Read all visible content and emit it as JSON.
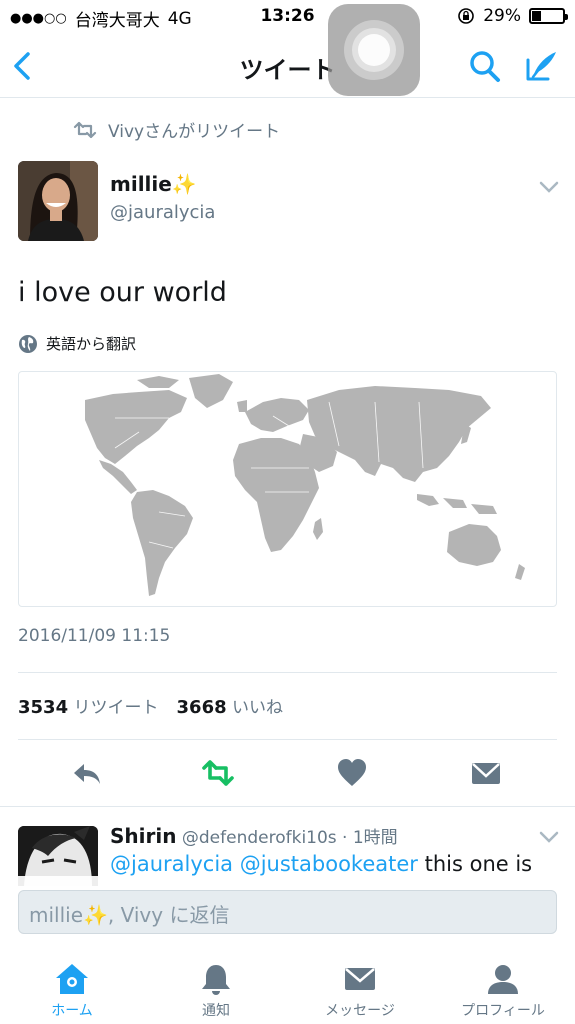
{
  "status_bar": {
    "signal": "●●●○○",
    "carrier": "台湾大哥大",
    "network": "4G",
    "time": "13:26",
    "battery_percent": "29%",
    "battery_level": 0.29
  },
  "nav": {
    "title": "ツイート",
    "back_icon": "chevron-left-icon",
    "search_icon": "search-icon",
    "compose_icon": "compose-icon"
  },
  "tweet": {
    "retweet_context": "Vivyさんがリツイート",
    "author_name": "millie",
    "author_emoji": "✨",
    "author_handle": "@jauralycia",
    "text": "i love our world",
    "translate_label": "英語から翻訳",
    "timestamp": "2016/11/09 11:15",
    "retweets_count": "3534",
    "retweets_label": "リツイート",
    "likes_count": "3668",
    "likes_label": "いいね"
  },
  "reply_preview": {
    "name": "Shirin",
    "handle_time": "@defenderofki10s · 1時間",
    "mention_1": "@jauralycia",
    "mention_2": "@justabookeater",
    "text_rest": " this one is"
  },
  "reply_box": {
    "name_prefix": "millie",
    "emoji": "✨",
    "placeholder_suffix": ", Vivy に返信"
  },
  "tabs": [
    {
      "label": "ホーム",
      "icon": "home-icon",
      "active": true
    },
    {
      "label": "通知",
      "icon": "bell-icon",
      "active": false
    },
    {
      "label": "メッセージ",
      "icon": "envelope-icon",
      "active": false
    },
    {
      "label": "プロフィール",
      "icon": "person-icon",
      "active": false
    }
  ],
  "colors": {
    "accent": "#1da1f2",
    "retweet_green": "#17bf63",
    "secondary_text": "#657786",
    "map_land": "#b4b4b4"
  }
}
